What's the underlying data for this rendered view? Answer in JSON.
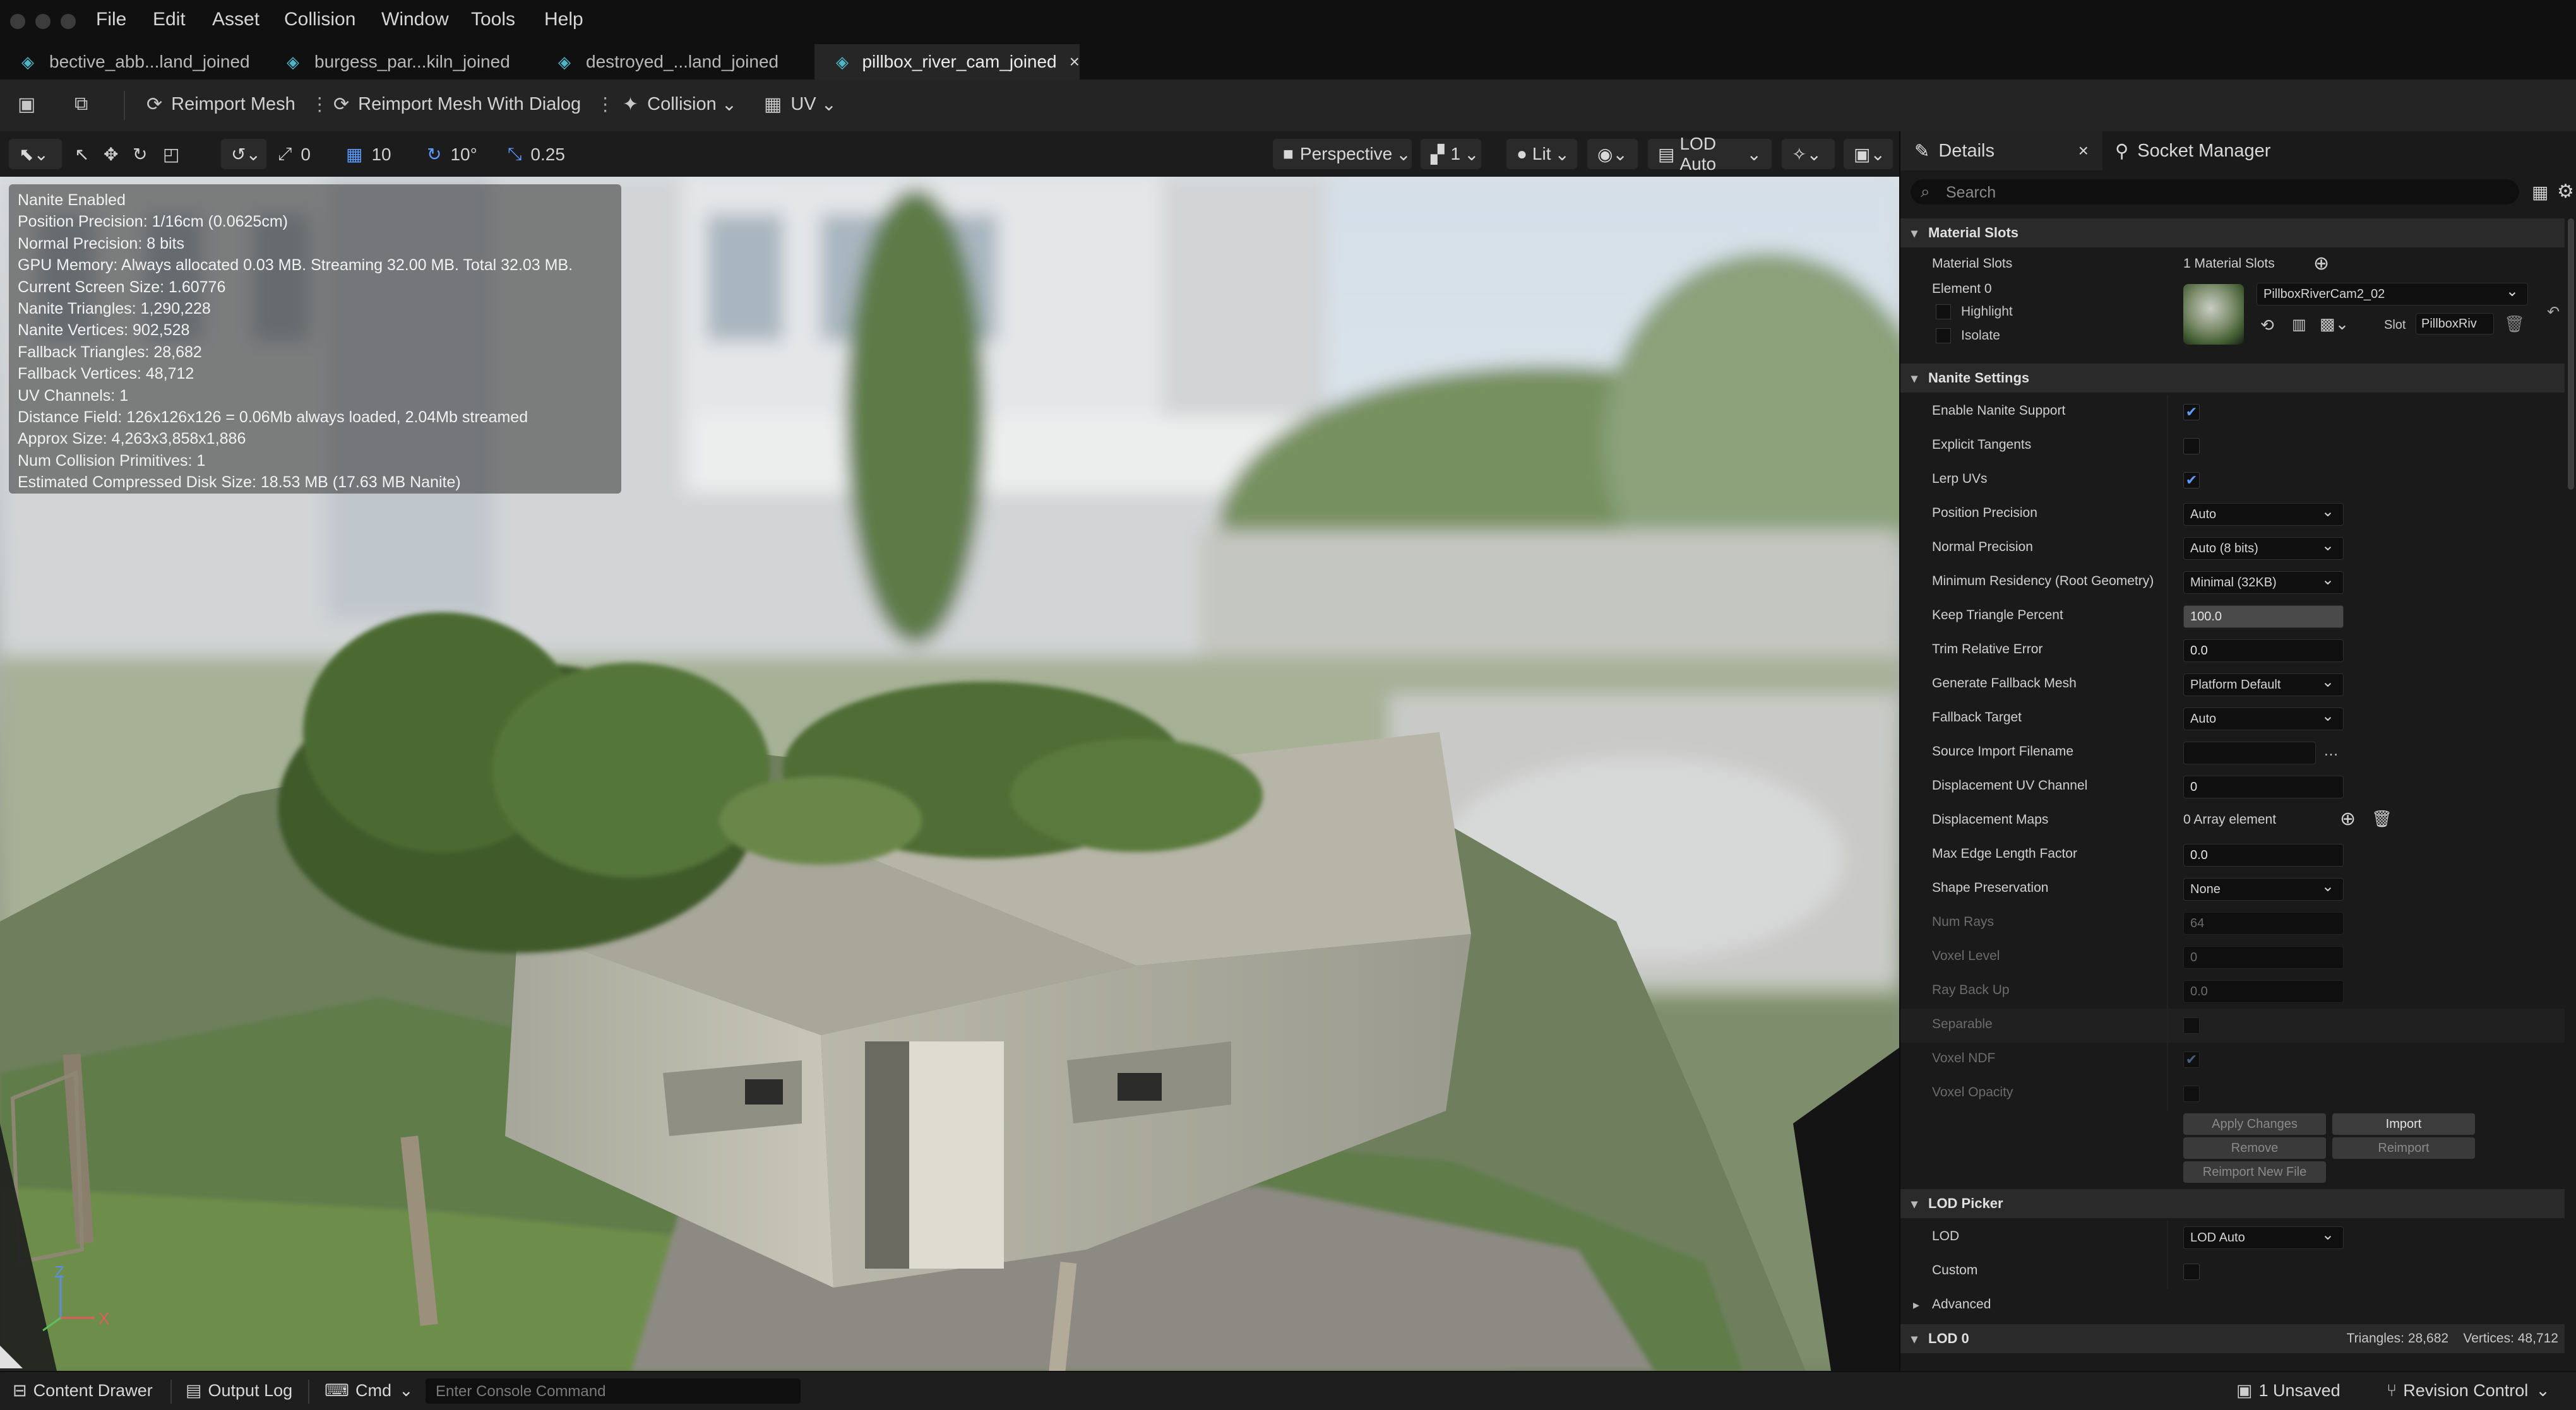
{
  "menu": [
    "File",
    "Edit",
    "Asset",
    "Collision",
    "Window",
    "Tools",
    "Help"
  ],
  "tabs": [
    "bective_abb...land_joined",
    "burgess_par...kiln_joined",
    "destroyed_...land_joined",
    "pillbox_river_cam_joined"
  ],
  "toolbar": {
    "reimport": "Reimport Mesh",
    "reimport_dialog": "Reimport Mesh With Dialog",
    "collision": "Collision",
    "uv": "UV"
  },
  "viewport_toolbar": {
    "rot_snap": "0",
    "grid_snap": "10",
    "angle_snap": "10°",
    "scale_snap": "0.25",
    "perspective": "Perspective",
    "cam_speed": "1",
    "lit": "Lit",
    "lod": "LOD Auto"
  },
  "stats": [
    "Nanite Enabled",
    "Position Precision: 1/16cm (0.0625cm)",
    "Normal Precision: 8 bits",
    "GPU Memory: Always allocated 0.03 MB. Streaming 32.00 MB. Total 32.03 MB.",
    "Current Screen Size: 1.60776",
    "Nanite Triangles: 1,290,228",
    "Nanite Vertices: 902,528",
    "Fallback Triangles: 28,682",
    "Fallback Vertices: 48,712",
    "UV Channels: 1",
    "Distance Field: 126x126x126 = 0.06Mb always loaded, 2.04Mb streamed",
    "Approx Size: 4,263x3,858x1,886",
    "Num Collision Primitives: 1",
    "Estimated Compressed Disk Size: 18.53 MB (17.63 MB Nanite)"
  ],
  "axis": {
    "z": "Z",
    "x": "X"
  },
  "panel": {
    "details_tab": "Details",
    "socket_tab": "Socket Manager",
    "search_placeholder": "Search",
    "material_section": "Material Slots",
    "material_slots_label": "Material Slots",
    "material_slots_value": "1 Material Slots",
    "element": "Element 0",
    "highlight": "Highlight",
    "isolate": "Isolate",
    "material_name": "PillboxRiverCam2_02",
    "slot_label": "Slot",
    "slot_value": "PillboxRiv",
    "nanite_section": "Nanite Settings",
    "rows": {
      "enable_nanite": "Enable Nanite Support",
      "explicit_tangents": "Explicit Tangents",
      "lerp_uvs": "Lerp UVs",
      "position_precision": "Position Precision",
      "position_precision_val": "Auto",
      "normal_precision": "Normal Precision",
      "normal_precision_val": "Auto (8 bits)",
      "min_residency": "Minimum Residency (Root Geometry)",
      "min_residency_val": "Minimal (32KB)",
      "keep_triangle": "Keep Triangle Percent",
      "keep_triangle_val": "100.0",
      "trim_error": "Trim Relative Error",
      "trim_error_val": "0.0",
      "gen_fallback": "Generate Fallback Mesh",
      "gen_fallback_val": "Platform Default",
      "fallback_target": "Fallback Target",
      "fallback_target_val": "Auto",
      "source_import": "Source Import Filename",
      "disp_uv": "Displacement UV Channel",
      "disp_uv_val": "0",
      "disp_maps": "Displacement Maps",
      "disp_maps_val": "0 Array element",
      "max_edge": "Max Edge Length Factor",
      "max_edge_val": "0.0",
      "shape_pres": "Shape Preservation",
      "shape_pres_val": "None",
      "num_rays": "Num Rays",
      "num_rays_val": "64",
      "voxel_level": "Voxel Level",
      "voxel_level_val": "0",
      "ray_back_up": "Ray Back Up",
      "ray_back_up_val": "0.0",
      "separable": "Separable",
      "voxel_ndf": "Voxel NDF",
      "voxel_opacity": "Voxel Opacity"
    },
    "buttons": {
      "apply": "Apply Changes",
      "import": "Import",
      "remove": "Remove",
      "reimport": "Reimport",
      "reimport_new": "Reimport New File"
    },
    "lod_section": "LOD Picker",
    "lod_label": "LOD",
    "lod_val": "LOD Auto",
    "custom_label": "Custom",
    "advanced": "Advanced",
    "lod0": "LOD 0",
    "lod0_stats": "Triangles: 28,682    Vertices: 48,712"
  },
  "bottom": {
    "content_drawer": "Content Drawer",
    "output_log": "Output Log",
    "cmd": "Cmd",
    "console_placeholder": "Enter Console Command",
    "unsaved": "1 Unsaved",
    "revision": "Revision Control"
  }
}
